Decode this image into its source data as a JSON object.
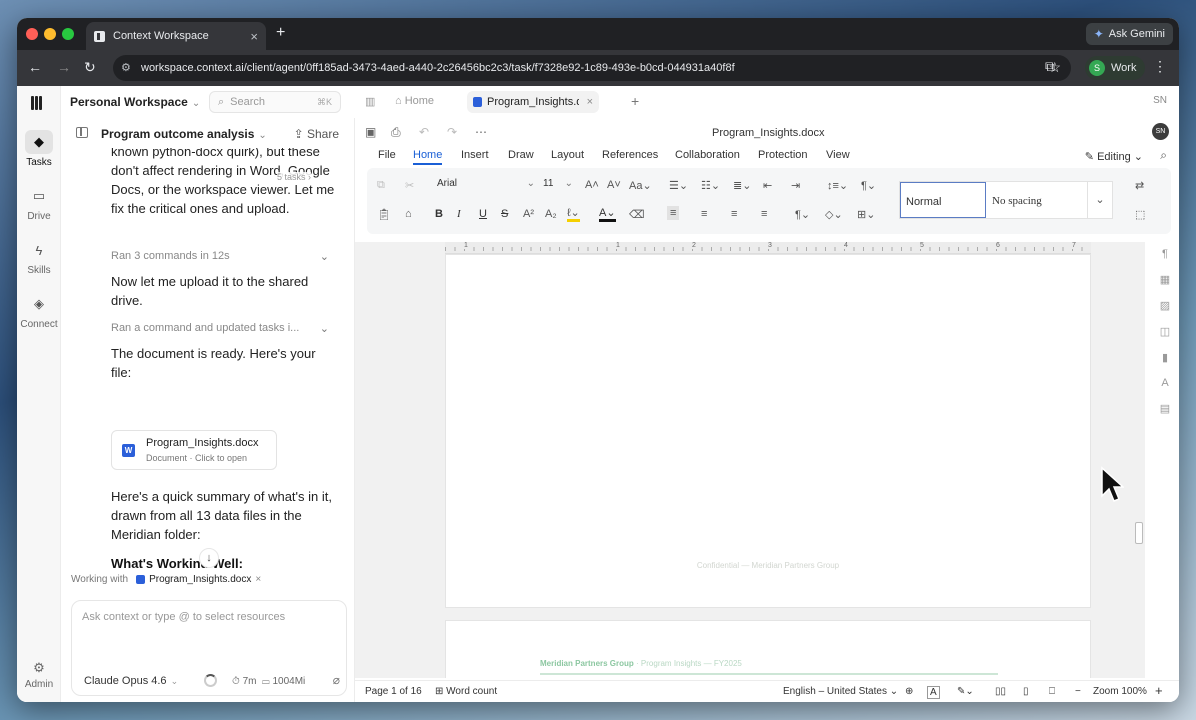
{
  "browser": {
    "tab_title": "Context Workspace",
    "new_tab": "+",
    "gemini_label": "Ask Gemini",
    "url": "workspace.context.ai/client/agent/0ff185ad-3473-4aed-a440-2c26456bc2c3/task/f7328e92-1c89-493e-b0cd-044931a40f8f",
    "profile_initial": "S",
    "profile_label": "Work"
  },
  "workspace": {
    "name": "Personal Workspace",
    "search_placeholder": "Search",
    "search_shortcut": "⌘K"
  },
  "rail": {
    "items": [
      {
        "label": "Tasks",
        "icon": "tasks-icon"
      },
      {
        "label": "Drive",
        "icon": "folder-icon"
      },
      {
        "label": "Skills",
        "icon": "bolt-icon"
      },
      {
        "label": "Connect",
        "icon": "layers-icon"
      }
    ],
    "admin": "Admin"
  },
  "chat": {
    "title": "Program outcome analysis",
    "share": "Share",
    "tasks_count": "5 tasks",
    "msg1": "known python-docx quirk), but these don't affect rendering in Word, Google Docs, or the workspace viewer. Let me fix the critical ones and upload.",
    "ran1": "Ran 3 commands in 12s",
    "msg2": "Now let me upload it to the shared drive.",
    "ran2": "Ran a command and updated tasks i...",
    "msg3": "The document is ready. Here's your file:",
    "file_name": "Program_Insights.docx",
    "file_sub": "Document · Click to open",
    "msg4": "Here's a quick summary of what's in it, drawn from all 13 data files in the Meridian folder:",
    "heading": "What's Working Well:",
    "working_with_label": "Working with",
    "working_with_file": "Program_Insights.docx",
    "composer_placeholder": "Ask context or type @ to select resources",
    "model": "Claude Opus 4.6",
    "time": "7m",
    "memory": "1004Mi"
  },
  "editor": {
    "home_tab": "Home",
    "doc_tab": "Program_Insights.docx",
    "user_initials": "SN",
    "doc_name": "Program_Insights.docx",
    "menus": [
      "File",
      "Home",
      "Insert",
      "Draw",
      "Layout",
      "References",
      "Collaboration",
      "Protection",
      "View"
    ],
    "editing": "Editing",
    "font": "Arial",
    "font_size": "11",
    "style_normal": "Normal",
    "style_nospacing": "No spacing",
    "ruler_numbers": [
      "1",
      "1",
      "2",
      "3",
      "4",
      "5",
      "6",
      "7"
    ],
    "page_footer": "Confidential — Meridian Partners Group",
    "page2_header_org": "Meridian Partners Group",
    "page2_header_rest": "· Program Insights — FY2025",
    "status": {
      "page": "Page 1 of 16",
      "word_count": "Word count",
      "language": "English – United States",
      "zoom": "Zoom 100%"
    }
  }
}
